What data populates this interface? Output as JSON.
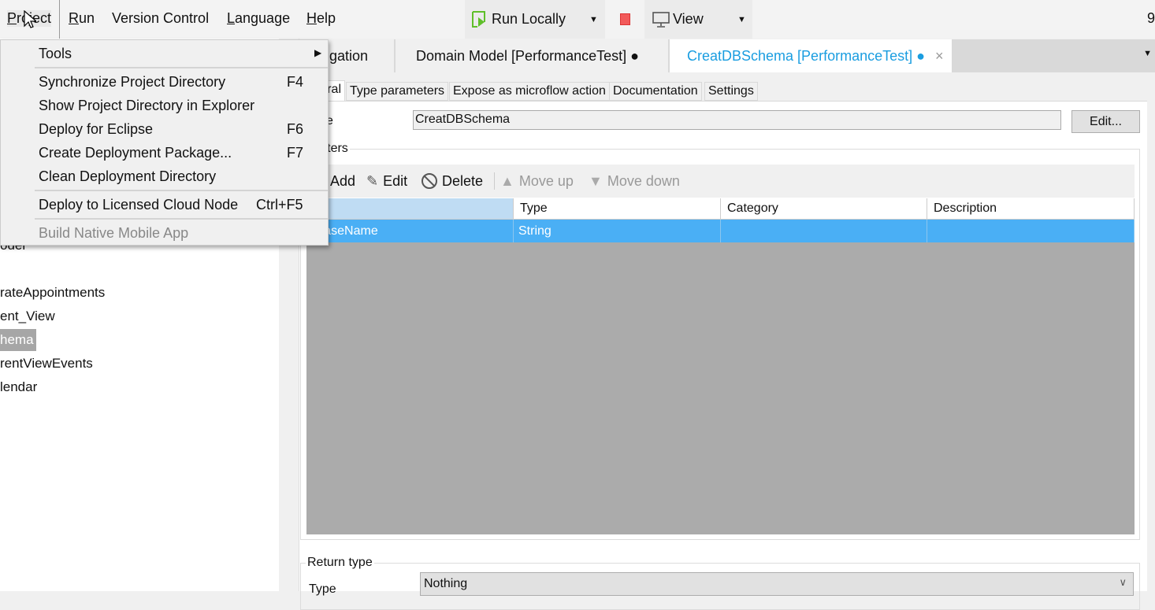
{
  "menubar": {
    "items": [
      "Project",
      "Run",
      "Version Control",
      "Language",
      "Help"
    ],
    "run_locally": "Run Locally",
    "view": "View",
    "clipped_right": "9"
  },
  "project_menu": {
    "items": [
      {
        "label": "Tools",
        "submenu": true
      },
      {
        "label": "Synchronize Project Directory",
        "shortcut": "F4"
      },
      {
        "label": "Show Project Directory in Explorer",
        "shortcut": ""
      },
      {
        "label": "Deploy for Eclipse",
        "shortcut": "F6"
      },
      {
        "label": "Create Deployment Package...",
        "shortcut": "F7"
      },
      {
        "label": "Clean Deployment Directory",
        "shortcut": ""
      },
      {
        "label": "Deploy to Licensed Cloud Node",
        "shortcut": "Ctrl+F5"
      },
      {
        "label": "Build Native Mobile App",
        "shortcut": "",
        "disabled": true
      }
    ]
  },
  "tree": {
    "items": [
      "odel",
      "rateAppointments",
      "ent_View",
      "hema",
      "rentViewEvents",
      "lendar"
    ],
    "selected": "hema"
  },
  "tabs": [
    {
      "label": "igation"
    },
    {
      "label": "Domain Model [PerformanceTest] ●"
    },
    {
      "label": "CreatDBSchema [PerformanceTest] ●",
      "active": true,
      "close": "×"
    }
  ],
  "subtabs": [
    "ral",
    "Type parameters",
    "Expose as microflow action",
    "Documentation",
    "Settings"
  ],
  "form": {
    "name_label": "e",
    "name_value": "CreatDBSchema",
    "edit_button": "Edit...",
    "parameters_legend": "ameters",
    "toolbar": {
      "add": "Add",
      "edit": "Edit",
      "delete": "Delete",
      "move_up": "Move up",
      "move_down": "Move down"
    },
    "table": {
      "headers": [
        "me",
        "Type",
        "Category",
        "Description"
      ],
      "rows": [
        [
          "tabaseName",
          "String",
          "",
          ""
        ]
      ]
    },
    "return_legend": "Return type",
    "type_label": "Type",
    "type_value": "Nothing"
  },
  "colors": {
    "accent": "#1a9de0",
    "selected_row": "#4aaff5",
    "header_selected": "#bfdcf3",
    "empty_grid": "#ababab",
    "stop": "#f25a5a",
    "run_green": "#5fbf2a"
  }
}
